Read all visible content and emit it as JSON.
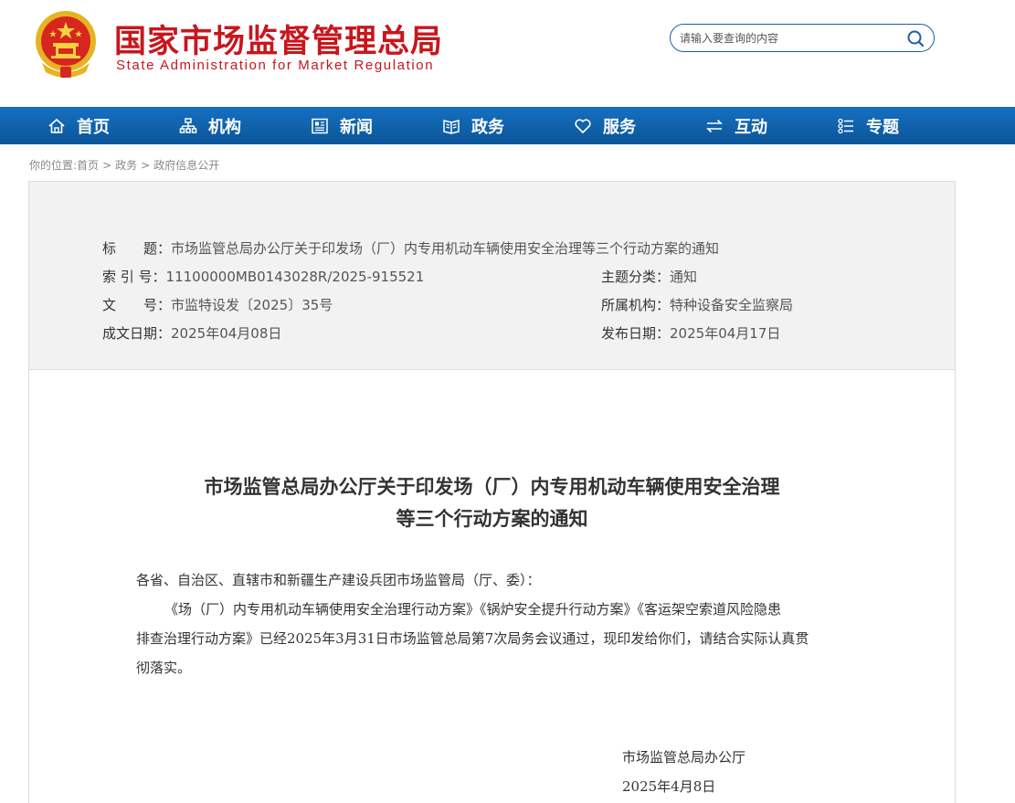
{
  "header": {
    "site_name_cn": "国家市场监督管理总局",
    "site_name_en": "State Administration for Market Regulation",
    "search_placeholder": "请输入要查询的内容",
    "emblem_icon": "national-emblem-icon"
  },
  "nav": [
    {
      "label": "首页",
      "icon": "home-icon"
    },
    {
      "label": "机构",
      "icon": "org-chart-icon"
    },
    {
      "label": "新闻",
      "icon": "newspaper-icon"
    },
    {
      "label": "政务",
      "icon": "government-book-icon"
    },
    {
      "label": "服务",
      "icon": "heart-icon"
    },
    {
      "label": "互动",
      "icon": "exchange-arrows-icon"
    },
    {
      "label": "专题",
      "icon": "topic-list-icon"
    }
  ],
  "breadcrumb": {
    "prefix": "你的位置:",
    "items": [
      "首页",
      "政务",
      "政府信息公开"
    ],
    "separator": ">"
  },
  "meta": {
    "title_label": "标　　题：",
    "title_value": "市场监管总局办公厅关于印发场（厂）内专用机动车辆使用安全治理等三个行动方案的通知",
    "index_label": "索 引 号：",
    "index_value": "11100000MB0143028R/2025-915521",
    "category_label": "主题分类：",
    "category_value": "通知",
    "docno_label": "文　　号：",
    "docno_value": "市监特设发〔2025〕35号",
    "org_label": "所属机构：",
    "org_value": "特种设备安全监察局",
    "created_label": "成文日期：",
    "created_value": "2025年04月08日",
    "published_label": "发布日期：",
    "published_value": "2025年04月17日"
  },
  "document": {
    "title_line1": "市场监管总局办公厅关于印发场（厂）内专用机动车辆使用安全治理",
    "title_line2": "等三个行动方案的通知",
    "salutation": "各省、自治区、直辖市和新疆生产建设兵团市场监管局（厅、委）：",
    "paragraph_line1": "《场（厂）内专用机动车辆使用安全治理行动方案》《锅炉安全提升行动方案》《客运架空索道风险隐患",
    "paragraph_line2": "排查治理行动方案》已经2025年3月31日市场监管总局第7次局务会议通过，现印发给你们，请结合实际认真贯",
    "paragraph_line3": "彻落实。",
    "signature_org": "市场监管总局办公厅",
    "signature_date": "2025年4月8日"
  },
  "colors": {
    "brand_red": "#c8161d",
    "nav_blue": "#0e5ba4",
    "meta_bg": "#f2f2f2"
  }
}
